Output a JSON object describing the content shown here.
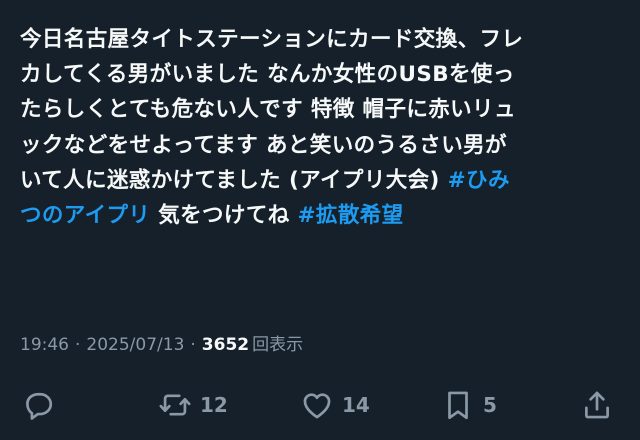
{
  "tweet": {
    "lines": [
      [
        {
          "text": "今日名古屋タイトステーションにカード交換、フレ",
          "hashtag": false
        }
      ],
      [
        {
          "text": "カしてくる男がいました  なんか女性のUSBを使っ",
          "hashtag": false
        }
      ],
      [
        {
          "text": "たらしくとても危ない人です 特徴 帽子に赤いリュ",
          "hashtag": false
        }
      ],
      [
        {
          "text": "ックなどをせよってます  あと笑いのうるさい男が",
          "hashtag": false
        }
      ],
      [
        {
          "text": "いて人に迷惑かけてました (アイプリ大会)  ",
          "hashtag": false
        },
        {
          "text": "#ひみ",
          "hashtag": true
        }
      ],
      [
        {
          "text": "つのアイプリ",
          "hashtag": true
        },
        {
          "text": " 気をつけてね   ",
          "hashtag": false
        },
        {
          "text": "#拡散希望",
          "hashtag": true
        }
      ]
    ]
  },
  "meta": {
    "time": "19:46",
    "separator": "·",
    "date": "2025/07/13",
    "views_count": "3652",
    "views_label": "回表示"
  },
  "actions": {
    "reply": {
      "icon": "reply-icon",
      "count": ""
    },
    "retweet": {
      "icon": "retweet-icon",
      "count": "12"
    },
    "like": {
      "icon": "heart-icon",
      "count": "14"
    },
    "bookmark": {
      "icon": "bookmark-icon",
      "count": "5"
    },
    "share": {
      "icon": "share-icon",
      "count": ""
    }
  },
  "colors": {
    "background": "#15202b",
    "text": "#f7f9f9",
    "muted": "#8b98a5",
    "hashtag": "#1d9bf0"
  }
}
